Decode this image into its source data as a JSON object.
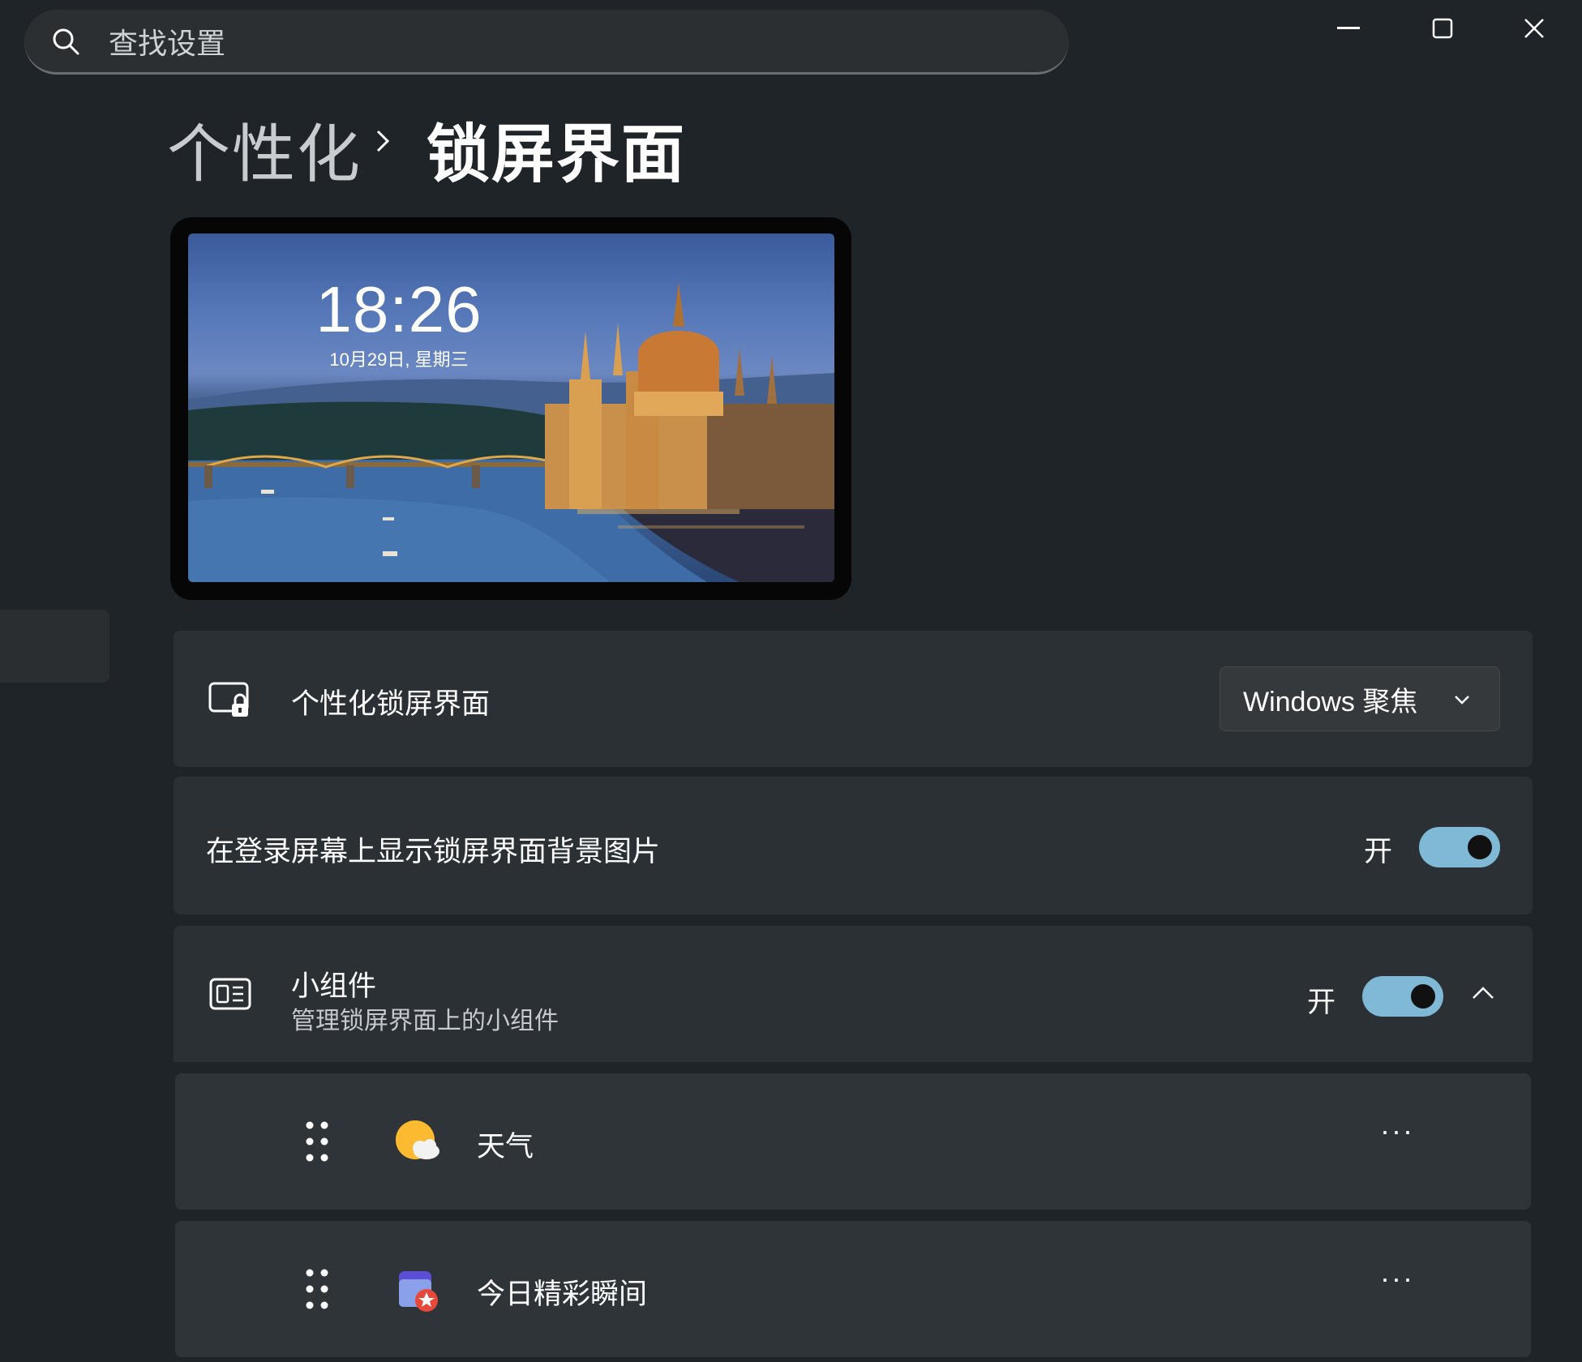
{
  "search": {
    "placeholder": "查找设置",
    "icon": "search-icon"
  },
  "window": {
    "minimize_icon": "minimize-icon",
    "maximize_icon": "maximize-icon",
    "close_icon": "close-icon"
  },
  "breadcrumb": {
    "parent": "个性化",
    "current": "锁屏界面"
  },
  "preview": {
    "time": "18:26",
    "date": "10月29日, 星期三"
  },
  "settings": {
    "personalize": {
      "label": "个性化锁屏界面",
      "icon": "lock-screen-icon",
      "value": "Windows 聚焦"
    },
    "login_bg": {
      "label": "在登录屏幕上显示锁屏界面背景图片",
      "state": "开",
      "on": true
    },
    "widgets": {
      "label": "小组件",
      "description": "管理锁屏界面上的小组件",
      "state": "开",
      "on": true,
      "icon": "widgets-icon"
    },
    "widget_items": [
      {
        "label": "天气",
        "icon": "weather-icon",
        "more": "···"
      },
      {
        "label": "今日精彩瞬间",
        "icon": "today-highlights-icon",
        "more": "···"
      }
    ]
  },
  "colors": {
    "background": "#1f2428",
    "card": "#2b3034",
    "accent": "#7fb9d6"
  }
}
